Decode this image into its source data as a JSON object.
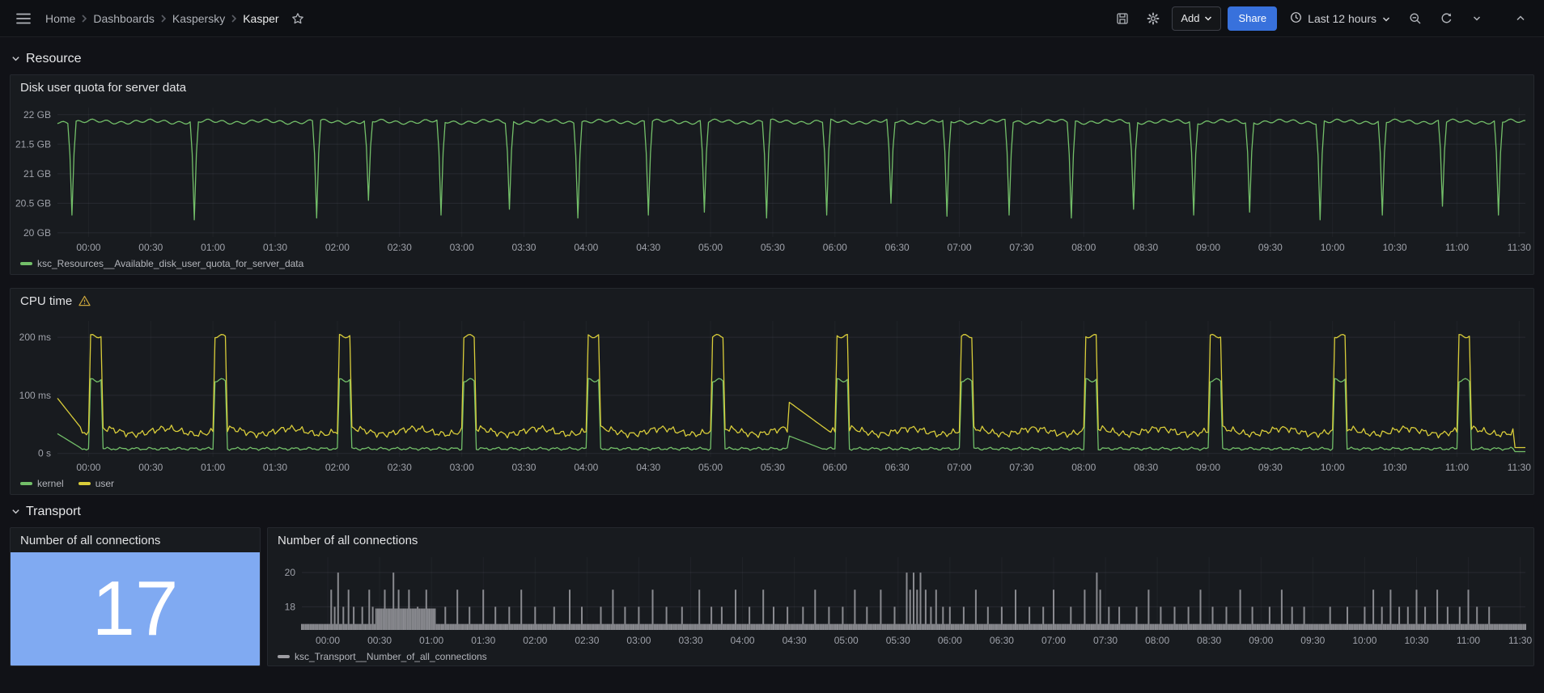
{
  "nav": {
    "breadcrumb": [
      {
        "label": "Home"
      },
      {
        "label": "Dashboards"
      },
      {
        "label": "Kaspersky"
      },
      {
        "label": "Kasper"
      }
    ],
    "actions": {
      "add_label": "Add",
      "share_label": "Share",
      "time_range_label": "Last 12 hours"
    }
  },
  "sections": {
    "resource": "Resource",
    "transport": "Transport"
  },
  "panels": {
    "disk": {
      "title": "Disk user quota for server data",
      "legend": "ksc_Resources__Available_disk_user_quota_for_server_data"
    },
    "cpu": {
      "title": "CPU time",
      "legend_kernel": "kernel",
      "legend_user": "user"
    },
    "stat": {
      "title": "Number of all connections",
      "value": "17"
    },
    "conn": {
      "title": "Number of all connections",
      "legend": "ksc_Transport__Number_of_all_connections"
    }
  },
  "colors": {
    "green": "#73BF69",
    "yellow": "#d9cd3a",
    "bar_gray": "#9e9ea3",
    "stat_bg": "#80aaf2",
    "share_blue": "#3871dc"
  },
  "time_ticks": [
    "00:00",
    "00:30",
    "01:00",
    "01:30",
    "02:00",
    "02:30",
    "03:00",
    "03:30",
    "04:00",
    "04:30",
    "05:00",
    "05:30",
    "06:00",
    "06:30",
    "07:00",
    "07:30",
    "08:00",
    "08:30",
    "09:00",
    "09:30",
    "10:00",
    "10:30",
    "11:00",
    "11:30"
  ],
  "chart_data": [
    {
      "type": "line",
      "title": "Disk user quota for server data",
      "x_range_minutes": [
        -15,
        693
      ],
      "y_domain": [
        19.93,
        22.12
      ],
      "y_ticks": [
        {
          "v": 20,
          "label": "20 GB"
        },
        {
          "v": 20.5,
          "label": "20.5 GB"
        },
        {
          "v": 21,
          "label": "21 GB"
        },
        {
          "v": 21.5,
          "label": "21.5 GB"
        },
        {
          "v": 22,
          "label": "22 GB"
        }
      ],
      "baseline_gb": 21.88,
      "dips_min_depth": [
        [
          -8,
          20.3
        ],
        [
          51,
          20.22
        ],
        [
          110,
          20.25
        ],
        [
          135,
          20.55
        ],
        [
          170,
          20.3
        ],
        [
          203,
          20.4
        ],
        [
          236,
          20.25
        ],
        [
          270,
          20.3
        ],
        [
          297,
          20.35
        ],
        [
          327,
          20.25
        ],
        [
          356,
          20.3
        ],
        [
          387,
          20.5
        ],
        [
          414,
          20.28
        ],
        [
          444,
          20.3
        ],
        [
          474,
          20.25
        ],
        [
          504,
          20.4
        ],
        [
          533,
          20.3
        ],
        [
          560,
          20.35
        ],
        [
          594,
          20.22
        ],
        [
          624,
          20.3
        ],
        [
          653,
          20.45
        ],
        [
          680,
          20.3
        ]
      ],
      "series": [
        {
          "name": "ksc_Resources__Available_disk_user_quota_for_server_data",
          "color": "#73BF69"
        }
      ]
    },
    {
      "type": "line",
      "title": "CPU time",
      "x_range_minutes": [
        -15,
        693
      ],
      "y_domain": [
        -6,
        228
      ],
      "y_ticks": [
        {
          "v": 0,
          "label": "0 s"
        },
        {
          "v": 100,
          "label": "100 ms"
        },
        {
          "v": 200,
          "label": "200 ms"
        }
      ],
      "series": [
        {
          "name": "kernel",
          "color": "#73BF69",
          "baseline_ms": 8,
          "spike_ms": 126
        },
        {
          "name": "user",
          "color": "#d9cd3a",
          "baseline_ms": 38,
          "spike_ms": 202
        }
      ],
      "spike_minutes": [
        2,
        62,
        122,
        182,
        242,
        302,
        362,
        422,
        482,
        542,
        602,
        662
      ],
      "minor_bump": {
        "start": 338,
        "end": 358,
        "user_peak_ms": 88,
        "kernel_peak_ms": 30
      }
    },
    {
      "type": "stat",
      "title": "Number of all connections",
      "value": 17
    },
    {
      "type": "bars",
      "title": "Number of all connections",
      "color": "#9e9ea3",
      "x_range_minutes": [
        -15,
        693
      ],
      "y_domain": [
        16.65,
        20.9
      ],
      "y_ticks": [
        {
          "v": 18,
          "label": "18"
        },
        {
          "v": 20,
          "label": "20"
        }
      ],
      "baseline": 17,
      "block": {
        "from": 28,
        "to": 62,
        "value": 17.9
      },
      "spikes": [
        [
          2,
          19
        ],
        [
          4,
          18
        ],
        [
          6,
          20
        ],
        [
          9,
          18
        ],
        [
          12,
          19
        ],
        [
          15,
          18
        ],
        [
          20,
          18
        ],
        [
          24,
          19
        ],
        [
          26,
          18
        ],
        [
          33,
          19
        ],
        [
          38,
          20
        ],
        [
          41,
          19
        ],
        [
          47,
          19
        ],
        [
          52,
          18
        ],
        [
          57,
          19
        ],
        [
          68,
          18
        ],
        [
          75,
          19
        ],
        [
          82,
          18
        ],
        [
          90,
          19
        ],
        [
          97,
          18
        ],
        [
          105,
          18
        ],
        [
          112,
          19
        ],
        [
          120,
          18
        ],
        [
          131,
          18
        ],
        [
          140,
          19
        ],
        [
          147,
          18
        ],
        [
          158,
          18
        ],
        [
          165,
          19
        ],
        [
          172,
          18
        ],
        [
          180,
          18
        ],
        [
          188,
          19
        ],
        [
          196,
          18
        ],
        [
          205,
          18
        ],
        [
          215,
          19
        ],
        [
          222,
          18
        ],
        [
          228,
          18
        ],
        [
          236,
          19
        ],
        [
          244,
          18
        ],
        [
          252,
          19
        ],
        [
          258,
          18
        ],
        [
          266,
          18
        ],
        [
          275,
          18
        ],
        [
          282,
          19
        ],
        [
          290,
          18
        ],
        [
          298,
          18
        ],
        [
          305,
          19
        ],
        [
          312,
          18
        ],
        [
          320,
          19
        ],
        [
          328,
          18
        ],
        [
          335,
          20
        ],
        [
          337,
          19
        ],
        [
          339,
          20
        ],
        [
          341,
          19
        ],
        [
          343,
          20
        ],
        [
          346,
          19
        ],
        [
          349,
          18
        ],
        [
          352,
          19
        ],
        [
          356,
          18
        ],
        [
          360,
          18
        ],
        [
          368,
          18
        ],
        [
          375,
          19
        ],
        [
          382,
          18
        ],
        [
          390,
          18
        ],
        [
          398,
          19
        ],
        [
          406,
          18
        ],
        [
          414,
          18
        ],
        [
          420,
          19
        ],
        [
          430,
          18
        ],
        [
          438,
          19
        ],
        [
          445,
          20
        ],
        [
          447,
          19
        ],
        [
          452,
          18
        ],
        [
          458,
          18
        ],
        [
          468,
          18
        ],
        [
          475,
          19
        ],
        [
          482,
          18
        ],
        [
          490,
          18
        ],
        [
          498,
          18
        ],
        [
          505,
          19
        ],
        [
          512,
          18
        ],
        [
          520,
          18
        ],
        [
          528,
          19
        ],
        [
          535,
          18
        ],
        [
          545,
          18
        ],
        [
          552,
          19
        ],
        [
          558,
          18
        ],
        [
          565,
          18
        ],
        [
          580,
          18
        ],
        [
          590,
          18
        ],
        [
          600,
          18
        ],
        [
          605,
          19
        ],
        [
          610,
          18
        ],
        [
          615,
          19
        ],
        [
          620,
          18
        ],
        [
          625,
          18
        ],
        [
          630,
          19
        ],
        [
          635,
          18
        ],
        [
          642,
          19
        ],
        [
          648,
          18
        ],
        [
          655,
          18
        ],
        [
          660,
          19
        ],
        [
          665,
          18
        ],
        [
          672,
          18
        ]
      ],
      "series_name": "ksc_Transport__Number_of_all_connections"
    }
  ]
}
